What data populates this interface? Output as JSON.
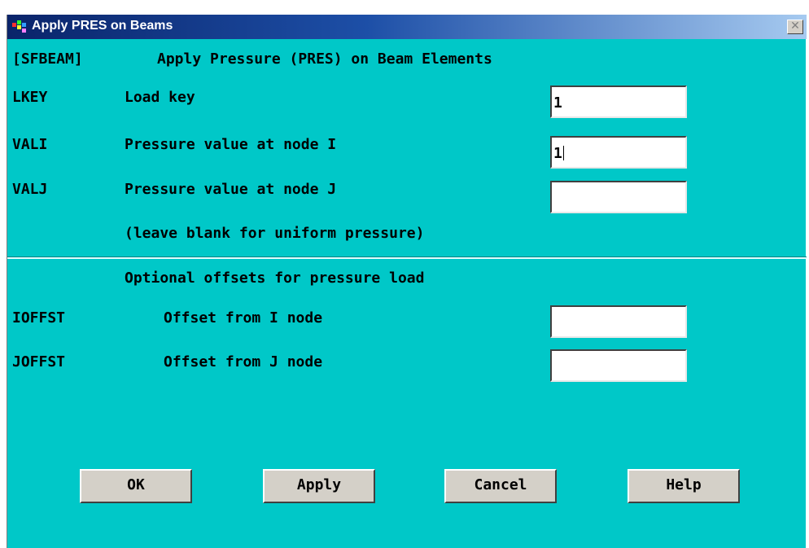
{
  "window": {
    "title": "Apply PRES on Beams",
    "close_glyph": "✕"
  },
  "header": {
    "command": "[SFBEAM]",
    "description": "Apply Pressure (PRES) on Beam Elements"
  },
  "fields": [
    {
      "key": "LKEY",
      "label": "Load key",
      "value": "1"
    },
    {
      "key": "VALI",
      "label": "Pressure value at node I",
      "value": "1"
    },
    {
      "key": "VALJ",
      "label": "Pressure value at node J",
      "value": ""
    }
  ],
  "note": "(leave blank for uniform pressure)",
  "offsets": {
    "heading": "Optional offsets for pressure load",
    "fields": [
      {
        "key": "IOFFST",
        "label": "Offset from I node",
        "value": ""
      },
      {
        "key": "JOFFST",
        "label": "Offset from J node",
        "value": ""
      }
    ]
  },
  "buttons": {
    "ok": "OK",
    "apply": "Apply",
    "cancel": "Cancel",
    "help": "Help"
  },
  "colors": {
    "dialog_background": "#00c8c8",
    "title_bar": "#0a246a",
    "button_face": "#d4d0c8"
  },
  "icons": {
    "app": "ansys-app-icon",
    "close": "close-icon"
  }
}
